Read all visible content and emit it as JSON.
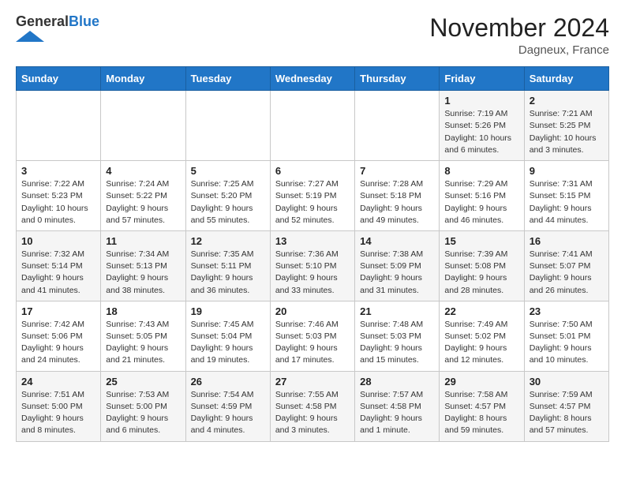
{
  "header": {
    "logo_general": "General",
    "logo_blue": "Blue",
    "month_title": "November 2024",
    "location": "Dagneux, France"
  },
  "calendar": {
    "days_of_week": [
      "Sunday",
      "Monday",
      "Tuesday",
      "Wednesday",
      "Thursday",
      "Friday",
      "Saturday"
    ],
    "weeks": [
      [
        {
          "day": "",
          "info": ""
        },
        {
          "day": "",
          "info": ""
        },
        {
          "day": "",
          "info": ""
        },
        {
          "day": "",
          "info": ""
        },
        {
          "day": "",
          "info": ""
        },
        {
          "day": "1",
          "info": "Sunrise: 7:19 AM\nSunset: 5:26 PM\nDaylight: 10 hours\nand 6 minutes."
        },
        {
          "day": "2",
          "info": "Sunrise: 7:21 AM\nSunset: 5:25 PM\nDaylight: 10 hours\nand 3 minutes."
        }
      ],
      [
        {
          "day": "3",
          "info": "Sunrise: 7:22 AM\nSunset: 5:23 PM\nDaylight: 10 hours\nand 0 minutes."
        },
        {
          "day": "4",
          "info": "Sunrise: 7:24 AM\nSunset: 5:22 PM\nDaylight: 9 hours\nand 57 minutes."
        },
        {
          "day": "5",
          "info": "Sunrise: 7:25 AM\nSunset: 5:20 PM\nDaylight: 9 hours\nand 55 minutes."
        },
        {
          "day": "6",
          "info": "Sunrise: 7:27 AM\nSunset: 5:19 PM\nDaylight: 9 hours\nand 52 minutes."
        },
        {
          "day": "7",
          "info": "Sunrise: 7:28 AM\nSunset: 5:18 PM\nDaylight: 9 hours\nand 49 minutes."
        },
        {
          "day": "8",
          "info": "Sunrise: 7:29 AM\nSunset: 5:16 PM\nDaylight: 9 hours\nand 46 minutes."
        },
        {
          "day": "9",
          "info": "Sunrise: 7:31 AM\nSunset: 5:15 PM\nDaylight: 9 hours\nand 44 minutes."
        }
      ],
      [
        {
          "day": "10",
          "info": "Sunrise: 7:32 AM\nSunset: 5:14 PM\nDaylight: 9 hours\nand 41 minutes."
        },
        {
          "day": "11",
          "info": "Sunrise: 7:34 AM\nSunset: 5:13 PM\nDaylight: 9 hours\nand 38 minutes."
        },
        {
          "day": "12",
          "info": "Sunrise: 7:35 AM\nSunset: 5:11 PM\nDaylight: 9 hours\nand 36 minutes."
        },
        {
          "day": "13",
          "info": "Sunrise: 7:36 AM\nSunset: 5:10 PM\nDaylight: 9 hours\nand 33 minutes."
        },
        {
          "day": "14",
          "info": "Sunrise: 7:38 AM\nSunset: 5:09 PM\nDaylight: 9 hours\nand 31 minutes."
        },
        {
          "day": "15",
          "info": "Sunrise: 7:39 AM\nSunset: 5:08 PM\nDaylight: 9 hours\nand 28 minutes."
        },
        {
          "day": "16",
          "info": "Sunrise: 7:41 AM\nSunset: 5:07 PM\nDaylight: 9 hours\nand 26 minutes."
        }
      ],
      [
        {
          "day": "17",
          "info": "Sunrise: 7:42 AM\nSunset: 5:06 PM\nDaylight: 9 hours\nand 24 minutes."
        },
        {
          "day": "18",
          "info": "Sunrise: 7:43 AM\nSunset: 5:05 PM\nDaylight: 9 hours\nand 21 minutes."
        },
        {
          "day": "19",
          "info": "Sunrise: 7:45 AM\nSunset: 5:04 PM\nDaylight: 9 hours\nand 19 minutes."
        },
        {
          "day": "20",
          "info": "Sunrise: 7:46 AM\nSunset: 5:03 PM\nDaylight: 9 hours\nand 17 minutes."
        },
        {
          "day": "21",
          "info": "Sunrise: 7:48 AM\nSunset: 5:03 PM\nDaylight: 9 hours\nand 15 minutes."
        },
        {
          "day": "22",
          "info": "Sunrise: 7:49 AM\nSunset: 5:02 PM\nDaylight: 9 hours\nand 12 minutes."
        },
        {
          "day": "23",
          "info": "Sunrise: 7:50 AM\nSunset: 5:01 PM\nDaylight: 9 hours\nand 10 minutes."
        }
      ],
      [
        {
          "day": "24",
          "info": "Sunrise: 7:51 AM\nSunset: 5:00 PM\nDaylight: 9 hours\nand 8 minutes."
        },
        {
          "day": "25",
          "info": "Sunrise: 7:53 AM\nSunset: 5:00 PM\nDaylight: 9 hours\nand 6 minutes."
        },
        {
          "day": "26",
          "info": "Sunrise: 7:54 AM\nSunset: 4:59 PM\nDaylight: 9 hours\nand 4 minutes."
        },
        {
          "day": "27",
          "info": "Sunrise: 7:55 AM\nSunset: 4:58 PM\nDaylight: 9 hours\nand 3 minutes."
        },
        {
          "day": "28",
          "info": "Sunrise: 7:57 AM\nSunset: 4:58 PM\nDaylight: 9 hours\nand 1 minute."
        },
        {
          "day": "29",
          "info": "Sunrise: 7:58 AM\nSunset: 4:57 PM\nDaylight: 8 hours\nand 59 minutes."
        },
        {
          "day": "30",
          "info": "Sunrise: 7:59 AM\nSunset: 4:57 PM\nDaylight: 8 hours\nand 57 minutes."
        }
      ]
    ]
  }
}
